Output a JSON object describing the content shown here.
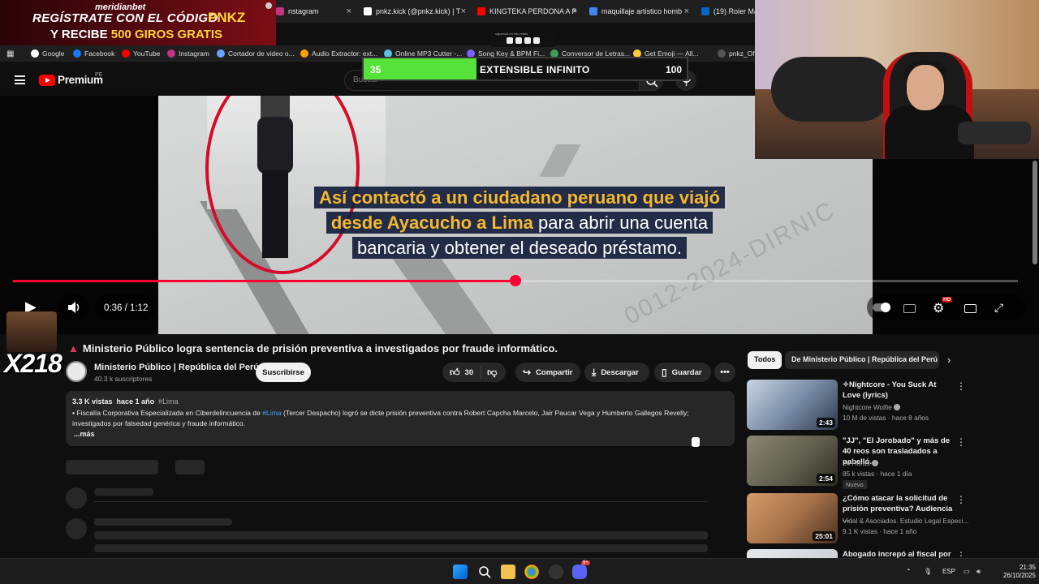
{
  "browser": {
    "tabs": [
      {
        "label": "nstagram",
        "color": "#c13584"
      },
      {
        "label": "pnkz.kick (@pnkz.kick) | T",
        "color": "#ffffff"
      },
      {
        "label": "KINGTEKA PERDONA A P",
        "color": "#ff0000"
      },
      {
        "label": "maquillaje artistico homb",
        "color": "#4285f4"
      },
      {
        "label": "(19) Roier Mall",
        "color": "#0a66c2"
      }
    ],
    "bookmarks": [
      {
        "label": "Google",
        "color": "#ffffff"
      },
      {
        "label": "Facebook",
        "color": "#1877f2"
      },
      {
        "label": "YouTube",
        "color": "#ff0000"
      },
      {
        "label": "Instagram",
        "color": "#c13584"
      },
      {
        "label": "Cortador de video o...",
        "color": "#6aa0ff"
      },
      {
        "label": "Audio Extractor: ext...",
        "color": "#f7a400"
      },
      {
        "label": "Online MP3 Cutter -...",
        "color": "#5bc0de"
      },
      {
        "label": "Song Key & BPM Fi...",
        "color": "#7b61ff"
      },
      {
        "label": "Conversor de Letras...",
        "color": "#3aa05a"
      },
      {
        "label": "Get Emoji — All...",
        "color": "#ffcc33"
      },
      {
        "label": "pnkz_Ofic",
        "color": "#555555"
      }
    ]
  },
  "youtube": {
    "brand": "Premium",
    "country": "PE",
    "search_placeholder": "Buscar"
  },
  "player": {
    "subtitle_highlight_1": "Así contactó a un ciudadano peruano que viajó",
    "subtitle_highlight_2": "desde Ayacucho a Lima",
    "subtitle_rest_2": " para abrir una cuenta",
    "subtitle_line_3": "bancaria y obtener el deseado préstamo.",
    "watermark": "0012-2024-DIRNIC",
    "current_time": "0:36",
    "duration": "1:12",
    "time_display": "0:36 / 1:12",
    "progress_fraction": 0.5,
    "hd_badge": "HD"
  },
  "overlays": {
    "ad_brand": "meridianbet",
    "ad_line1": "REGÍSTRATE CON EL CÓDIGO",
    "ad_code": "PNKZ",
    "ad_line2_pre": "Y RECIBE ",
    "ad_line2_gold": "500 GIROS GRATIS",
    "socials_label": "síguenos en mis redes",
    "timer_left": "35",
    "timer_label": "EXTENSIBLE INFINITO",
    "timer_right": "100",
    "timer_fraction": 0.35,
    "emote_count": "X218"
  },
  "video": {
    "title": "Ministerio Público logra sentencia de prisión preventiva a investigados por fraude informático.",
    "channel": "Ministerio Público | República del Perú",
    "subscribers": "40.3 k suscriptores",
    "subscribe_label": "Suscribirse",
    "likes": "30",
    "share_label": "Compartir",
    "download_label": "Descargar",
    "save_label": "Guardar",
    "views": "3.3 K vistas",
    "age": "hace 1 año",
    "hashtag": "#Lima",
    "desc_pre": "Fiscalía Corporativa Especializada en Ciberdelincuencia de ",
    "desc_link": "#Lima",
    "desc_post": " (Tercer Despacho) logró se dicte prisión preventiva contra Robert Capcha Marcelo, Jair Paucar Vega y Humberto Gallegos Revelly; investigados por falsedad genérica y fraude informático.",
    "more_label": "...más"
  },
  "sidebar": {
    "chips": [
      "Todos",
      "De Ministerio Público | República del Perú"
    ],
    "recommendations": [
      {
        "title": "✧Nightcore - You Suck At Love (lyrics)",
        "channel": "Nightcore Wolfie",
        "verified": true,
        "meta": "10 M de vistas · hace 8 años",
        "duration": "2:43",
        "badge": "",
        "color": "#7c8fa8"
      },
      {
        "title": "\"JJ\", \"El Jorobado\" y más de 40 reos son trasladados a pabelló...",
        "channel": "24 Horas",
        "verified": true,
        "meta": "85 k vistas · hace 1 día",
        "duration": "2:54",
        "badge": "Nuevo",
        "color": "#7d7a66"
      },
      {
        "title": "¿Cómo atacar la solicitud de prisión preventiva? Audiencia ...",
        "channel": "Vidal & Asociados. Estudio Legal Especi...",
        "verified": false,
        "meta": "9.1 K vistas · hace 1 año",
        "duration": "25:01",
        "badge": "",
        "color": "#a8734a"
      },
      {
        "title": "Abogado increpó al fiscal por",
        "channel": "",
        "verified": false,
        "meta": "",
        "duration": "",
        "badge": "",
        "color": "#c4c8cc"
      }
    ]
  },
  "taskbar": {
    "language": "ESP",
    "time": "21:35",
    "date": "26/10/2025",
    "discord_badge": "9+"
  }
}
